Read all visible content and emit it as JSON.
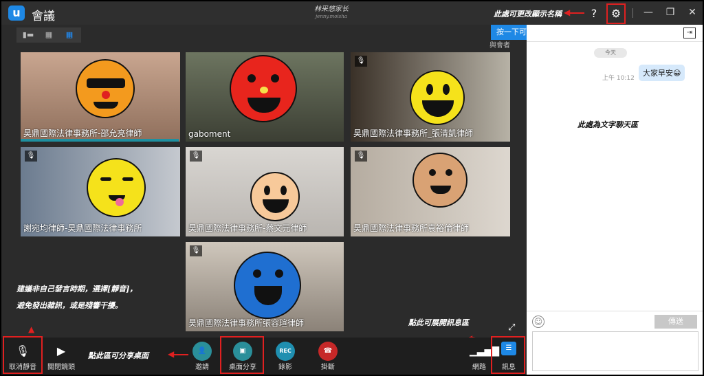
{
  "app": {
    "logo": "u",
    "title": "會議"
  },
  "watermark": {
    "line1": "林采悠家长",
    "line2": "jenny.moisha"
  },
  "annotations": {
    "settings_note": "此處可更改顯示名稱",
    "chat_area_note": "此處為文字聊天區",
    "mute_note_line1": "建議非自己發言時期，選擇[靜音]，",
    "mute_note_line2": "避免發出雜訊，或是殘響干擾。",
    "share_note": "點此區可分享桌面",
    "message_note": "點此可展開訊息區"
  },
  "titlebar": {
    "help": "?",
    "settings_icon": "gear-icon",
    "minimize": "—",
    "restore": "❐",
    "close": "✕"
  },
  "tooltip": {
    "text": "按一下可觀看教學課程影片！",
    "close": "✕"
  },
  "layout": {
    "btn1": "▮▬",
    "btn2": "▦",
    "btn3": "▦"
  },
  "participants_label": "與會者",
  "videos": [
    {
      "name": "昊鼎國際法律事務所-邵允亮律師",
      "muted": false
    },
    {
      "name": "gaboment",
      "muted": false
    },
    {
      "name": "昊鼎國際法律事務所_張清凱律師",
      "muted": true
    },
    {
      "name": "謝宛均律師-昊鼎國際法律事務所",
      "muted": true
    },
    {
      "name": "昊鼎國際法律事務所-蔡文元律師",
      "muted": true
    },
    {
      "name": "昊鼎國際法律事務所袁裕倫律師",
      "muted": true
    },
    {
      "name": "昊鼎國際法律事務所張容瑄律師",
      "muted": true
    }
  ],
  "chat": {
    "today": "今天",
    "message_time": "上午 10:12",
    "message_text": "大家早安😀",
    "send_label": "傳送",
    "emoji_icon": "☺"
  },
  "toolbar": {
    "mute_label": "取消靜音",
    "camera_label": "關閉鏡頭",
    "invite_label": "邀請",
    "share_label": "桌面分享",
    "record_label": "錄影",
    "record_icon_text": "REC",
    "hangup_label": "掛斷",
    "network_label": "網路",
    "message_label": "訊息"
  },
  "colors": {
    "accent": "#1e88e5",
    "highlight_box": "#e02020",
    "toolbar_bg": "#1e1e1e"
  }
}
